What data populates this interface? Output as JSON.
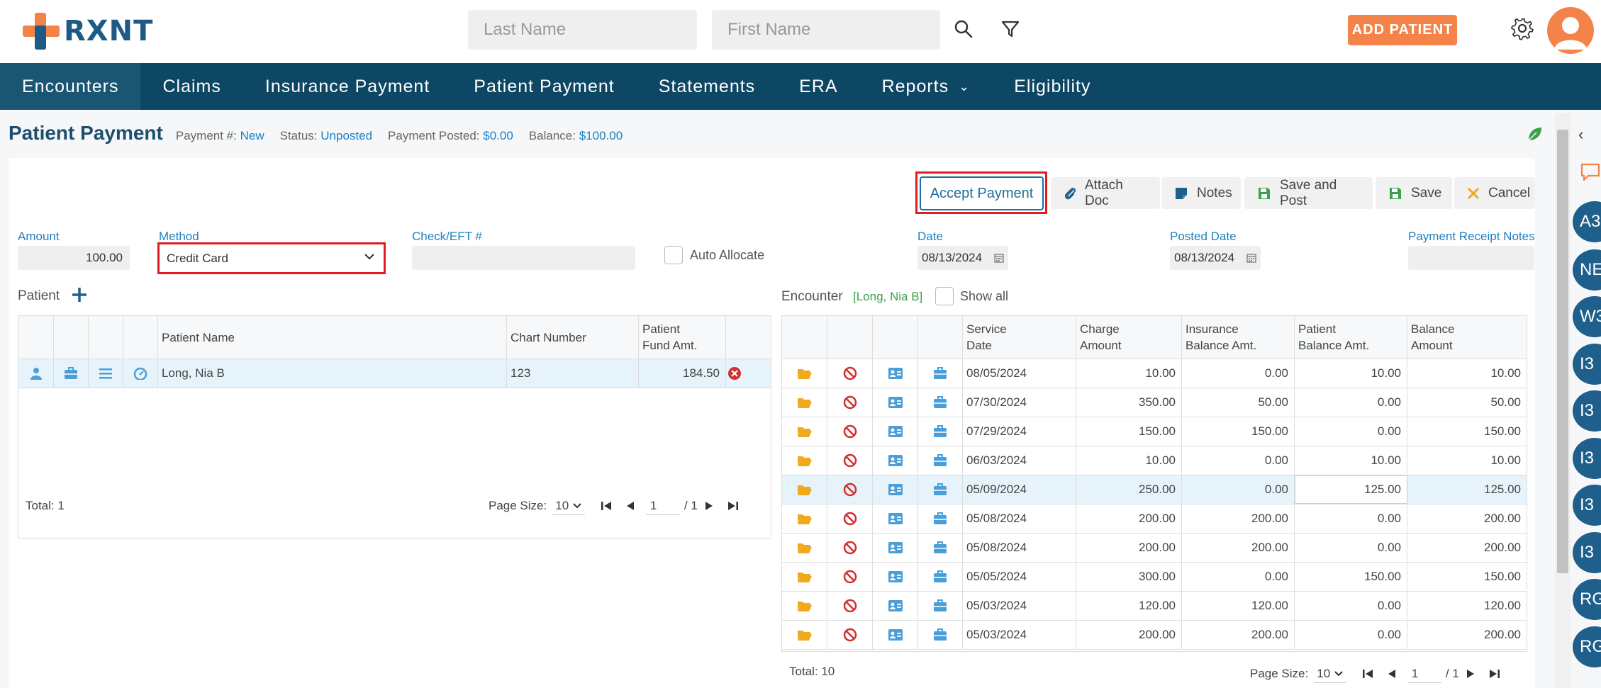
{
  "header": {
    "logo_text": "RXNT",
    "last_name_placeholder": "Last Name",
    "first_name_placeholder": "First Name",
    "add_patient_label": "ADD PATIENT"
  },
  "nav": {
    "items": [
      "Encounters",
      "Claims",
      "Insurance Payment",
      "Patient Payment",
      "Statements",
      "ERA",
      "Reports",
      "Eligibility"
    ],
    "active_index": 0
  },
  "page": {
    "title": "Patient Payment",
    "payment_no_label": "Payment #:",
    "payment_no_value": "New",
    "status_label": "Status:",
    "status_value": "Unposted",
    "posted_label": "Payment Posted:",
    "posted_value": "$0.00",
    "balance_label": "Balance:",
    "balance_value": "$100.00"
  },
  "toolbar": {
    "accept_payment": "Accept Payment",
    "attach_doc": "Attach Doc",
    "notes": "Notes",
    "save_and_post": "Save and Post",
    "save": "Save",
    "cancel": "Cancel"
  },
  "form": {
    "amount_label": "Amount",
    "amount_value": "100.00",
    "method_label": "Method",
    "method_value": "Credit Card",
    "check_label": "Check/EFT #",
    "check_value": "",
    "auto_allocate_label": "Auto Allocate",
    "date_label": "Date",
    "date_value": "08/13/2024",
    "posted_date_label": "Posted Date",
    "posted_date_value": "08/13/2024",
    "receipt_notes_label": "Payment Receipt Notes",
    "receipt_notes_value": ""
  },
  "patient_grid": {
    "section_label": "Patient",
    "columns": {
      "name": "Patient Name",
      "chart": "Chart Number",
      "fund_1": "Patient",
      "fund_2": "Fund Amt."
    },
    "rows": [
      {
        "name": "Long, Nia B",
        "chart": "123",
        "fund": "184.50"
      }
    ],
    "total": "Total: 1",
    "page_size_label": "Page Size:",
    "page_size": "10",
    "page": "1",
    "page_of": "/ 1"
  },
  "encounter_grid": {
    "section_label": "Encounter",
    "patient_tag": "[Long, Nia B]",
    "show_all_label": "Show all",
    "columns": {
      "service_1": "Service",
      "service_2": "Date",
      "charge_1": "Charge",
      "charge_2": "Amount",
      "ins_1": "Insurance",
      "ins_2": "Balance Amt.",
      "pat_1": "Patient",
      "pat_2": "Balance Amt.",
      "bal_1": "Balance",
      "bal_2": "Amount"
    },
    "rows": [
      {
        "date": "08/05/2024",
        "charge": "10.00",
        "ins": "0.00",
        "pat": "10.00",
        "bal": "10.00"
      },
      {
        "date": "07/30/2024",
        "charge": "350.00",
        "ins": "50.00",
        "pat": "0.00",
        "bal": "50.00"
      },
      {
        "date": "07/29/2024",
        "charge": "150.00",
        "ins": "150.00",
        "pat": "0.00",
        "bal": "150.00"
      },
      {
        "date": "06/03/2024",
        "charge": "10.00",
        "ins": "0.00",
        "pat": "10.00",
        "bal": "10.00"
      },
      {
        "date": "05/09/2024",
        "charge": "250.00",
        "ins": "0.00",
        "pat": "125.00",
        "bal": "125.00"
      },
      {
        "date": "05/08/2024",
        "charge": "200.00",
        "ins": "200.00",
        "pat": "0.00",
        "bal": "200.00"
      },
      {
        "date": "05/08/2024",
        "charge": "200.00",
        "ins": "200.00",
        "pat": "0.00",
        "bal": "200.00"
      },
      {
        "date": "05/05/2024",
        "charge": "300.00",
        "ins": "0.00",
        "pat": "150.00",
        "bal": "150.00"
      },
      {
        "date": "05/03/2024",
        "charge": "120.00",
        "ins": "120.00",
        "pat": "0.00",
        "bal": "120.00"
      },
      {
        "date": "05/03/2024",
        "charge": "200.00",
        "ins": "200.00",
        "pat": "0.00",
        "bal": "200.00"
      }
    ],
    "selected_index": 4,
    "total": "Total: 10",
    "page_size_label": "Page Size:",
    "page_size": "10",
    "page": "1",
    "page_of": "/ 1"
  },
  "rail": {
    "badges": [
      "A3",
      "NE",
      "W3",
      "I3",
      "I3",
      "I3",
      "I3",
      "I3",
      "RG",
      "RG"
    ]
  },
  "colors": {
    "nav_bg": "#0e4763",
    "accent_orange": "#f4834a",
    "link_blue": "#1f7fbf",
    "highlight_red": "#e21b23",
    "folder_yellow": "#f0a81c",
    "no_red": "#d32f2f"
  }
}
